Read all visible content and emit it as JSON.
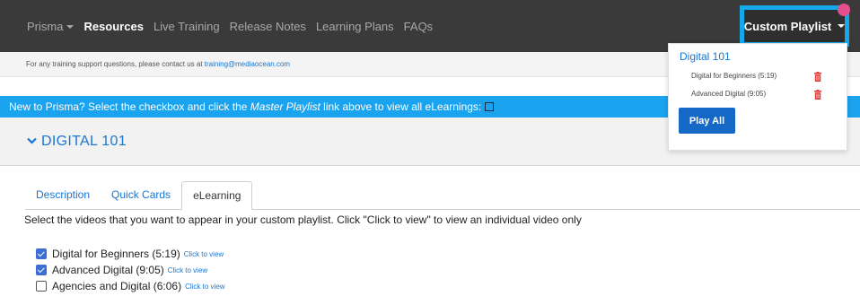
{
  "nav": {
    "items": [
      {
        "label": "Prisma",
        "has_caret": true,
        "active": false
      },
      {
        "label": "Resources",
        "active": true
      },
      {
        "label": "Live Training",
        "active": false
      },
      {
        "label": "Release Notes",
        "active": false
      },
      {
        "label": "Learning Plans",
        "active": false
      },
      {
        "label": "FAQs",
        "active": false
      }
    ],
    "custom_playlist_label": "Custom Playlist"
  },
  "support": {
    "text": "For any training support questions, please contact us at ",
    "email": "training@mediaocean.com"
  },
  "banner": {
    "before": "New to Prisma? Select the checkbox and click the ",
    "emphasis": "Master Playlist",
    "after": " link above to view all eLearnings:"
  },
  "section": {
    "title": "DIGITAL 101",
    "tabs": [
      {
        "label": "Description",
        "active": false
      },
      {
        "label": "Quick Cards",
        "active": false
      },
      {
        "label": "eLearning",
        "active": true
      }
    ],
    "instructions": "Select the videos that you want to appear in your custom playlist. Click \"Click to view\" to view an individual video only",
    "videos": [
      {
        "label": "Digital for Beginners (5:19)",
        "checked": true,
        "link": "Click to view"
      },
      {
        "label": "Advanced Digital (9:05)",
        "checked": true,
        "link": "Click to view"
      },
      {
        "label": "Agencies and Digital (6:06)",
        "checked": false,
        "link": "Click to view"
      }
    ]
  },
  "playlist_dropdown": {
    "heading": "Digital 101",
    "items": [
      {
        "label": "Digital for Beginners (5:19)"
      },
      {
        "label": "Advanced Digital (9:05)"
      }
    ],
    "play_all_label": "Play All"
  },
  "colors": {
    "navbar": "#3a3a3a",
    "highlight_border": "#15a8e9",
    "banner": "#1aa3ee",
    "link": "#1976d2",
    "trash": "#e53935",
    "button": "#1668c7"
  }
}
